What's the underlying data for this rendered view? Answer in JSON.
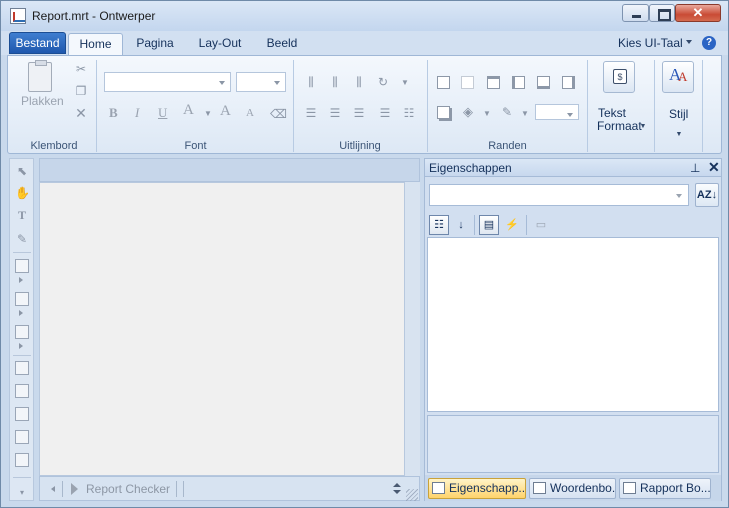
{
  "window": {
    "title": "Report.mrt  - Ontwerper",
    "close_glyph": "✕"
  },
  "ribbon_tabs": {
    "file": "Bestand",
    "tabs": [
      "Home",
      "Pagina",
      "Lay-Out",
      "Beeld"
    ],
    "active": "Home",
    "ui_language": "Kies UI-Taal",
    "help_glyph": "?"
  },
  "groups": {
    "clipboard": {
      "label": "Klembord",
      "paste": "Plakken"
    },
    "font": {
      "label": "Font",
      "bold": "B",
      "italic": "I",
      "underline": "U",
      "color": "A",
      "grow": "A",
      "shrink": "A"
    },
    "alignment": {
      "label": "Uitlijning"
    },
    "borders": {
      "label": "Randen"
    },
    "text_format": {
      "label_line1": "Tekst",
      "label_line2": "Formaat"
    },
    "style": {
      "label": "Stijl"
    }
  },
  "designer": {
    "report_checker": "Report Checker"
  },
  "properties_panel": {
    "title": "Eigenschappen",
    "pin_glyph": "⊥",
    "close_glyph": "✕",
    "sort_glyph": "AZ↓",
    "bottom_tabs": [
      "Eigenschapp...",
      "Woordenbo...",
      "Rapport Bo..."
    ],
    "active_tab": "Eigenschapp..."
  }
}
